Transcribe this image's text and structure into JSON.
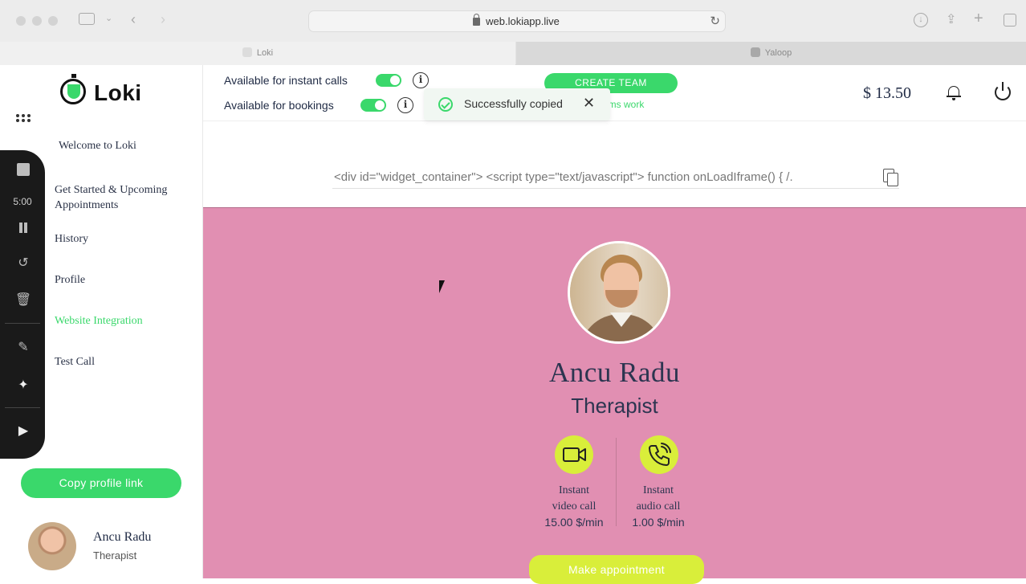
{
  "browser": {
    "url": "web.lokiapp.live",
    "tabs": [
      {
        "label": "Loki"
      },
      {
        "label": "Yaloop"
      }
    ]
  },
  "logo": {
    "text": "Loki"
  },
  "recorder": {
    "timer": "5:00"
  },
  "sidebar": {
    "welcome": "Welcome to Loki",
    "items": [
      {
        "label": "Get Started & Upcoming Appointments"
      },
      {
        "label": "History"
      },
      {
        "label": "Profile"
      },
      {
        "label": "Website Integration",
        "active": true
      },
      {
        "label": "Test Call"
      }
    ],
    "copy_button": "Copy profile link",
    "profile": {
      "name": "Ancu Radu",
      "role": "Therapist"
    }
  },
  "header": {
    "toggle_instant": {
      "label": "Available for instant calls",
      "on": true
    },
    "toggle_bookings": {
      "label": "Available for bookings",
      "on": true
    },
    "create_team": "CREATE TEAM",
    "teams_note": "ams work",
    "balance": "$ 13.50"
  },
  "toast": {
    "message": "Successfully copied"
  },
  "embed": {
    "code": "<div id=\"widget_container\">  <script type=\"text/javascript\">  function onLoadIframe() {  /."
  },
  "preview": {
    "name": "Ancu Radu",
    "role": "Therapist",
    "video": {
      "label_line1": "Instant",
      "label_line2": "video call",
      "price": "15.00 $/min"
    },
    "audio": {
      "label_line1": "Instant",
      "label_line2": "audio call",
      "price": "1.00 $/min"
    },
    "appointment_button": "Make appointment"
  },
  "colors": {
    "accent": "#3ad86b",
    "preview_bg": "#e18fb2",
    "call_button": "#d9ee3a",
    "text_dark": "#1f2a44"
  }
}
